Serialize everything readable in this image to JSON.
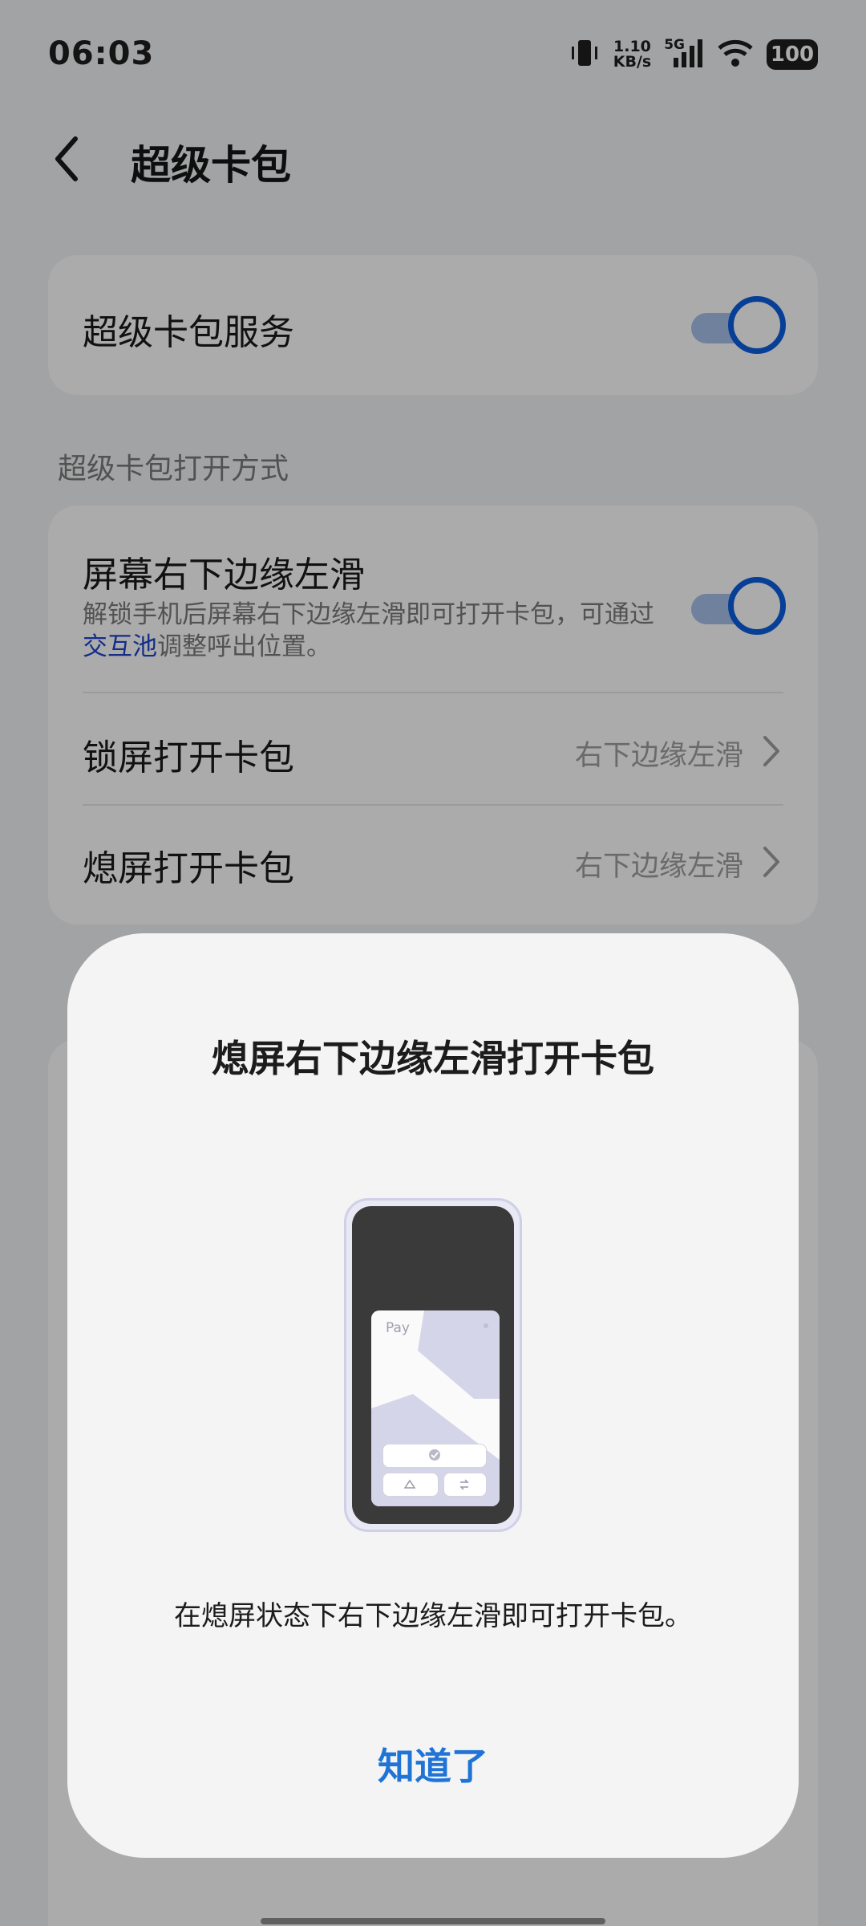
{
  "status_bar": {
    "time": "06:03",
    "speed_value": "1.10",
    "speed_unit": "KB/s",
    "network": "5G",
    "battery": "100"
  },
  "header": {
    "title": "超级卡包"
  },
  "service_card": {
    "label": "超级卡包服务",
    "enabled": true
  },
  "open_methods": {
    "section_label": "超级卡包打开方式",
    "swipe": {
      "label": "屏幕右下边缘左滑",
      "desc_before": "解锁手机后屏幕右下边缘左滑即可打开卡包，可通过",
      "desc_link": "交互池",
      "desc_after": "调整呼出位置。",
      "enabled": true
    },
    "lock_screen": {
      "label": "锁屏打开卡包",
      "value": "右下边缘左滑"
    },
    "screen_off": {
      "label": "熄屏打开卡包",
      "value": "右下边缘左滑"
    }
  },
  "dialog": {
    "title": "熄屏右下边缘左滑打开卡包",
    "illustration_label": "Pay",
    "message": "在熄屏状态下右下边缘左滑即可打开卡包。",
    "confirm_label": "知道了"
  },
  "colors": {
    "accent": "#0c5ee0",
    "link": "#1f43c9",
    "dialog_button": "#1f74d6"
  }
}
